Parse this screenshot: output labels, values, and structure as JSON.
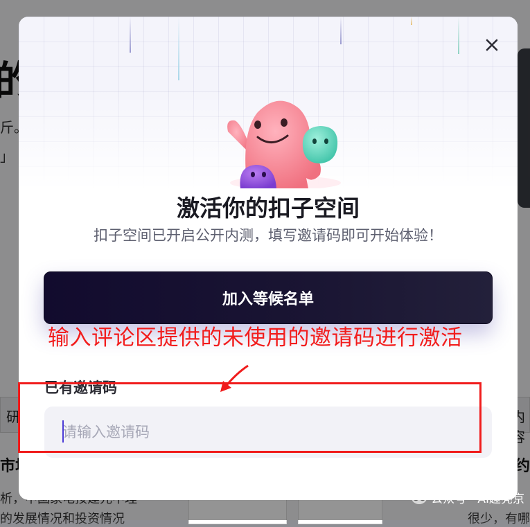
{
  "background": {
    "heading_fragment": "的",
    "line1_fragment": "斤。",
    "line2_fragment": "」",
    "tab_left": "研",
    "tab_right": "内容",
    "bottom_left": "市场",
    "bottom_right": "行约",
    "footer_line1": "析，中国家电按建元中理",
    "footer_line2": "的发展情况和投资情况",
    "footer_right": "很少，有哪"
  },
  "watermark": {
    "text": "公众号 · AI趣亮京"
  },
  "modal": {
    "title": "激活你的扣子空间",
    "subtitle": "扣子空间已开启公开内测，填写邀请码即可开始体验！",
    "waitlist_button": "加入等候名单",
    "invite_label": "已有邀请码",
    "invite_input": {
      "value": "",
      "placeholder": "请输入邀请码"
    }
  },
  "annotation": {
    "text": "输入评论区提供的未使用的邀请码进行激活"
  },
  "icons": {
    "close": "close-icon",
    "mascot": "mascot-illustration",
    "arrow": "annotation-arrow"
  },
  "colors": {
    "annotation_red": "#f01c1c",
    "button_dark": "#120b2e",
    "input_bg": "#f2f2f7"
  }
}
